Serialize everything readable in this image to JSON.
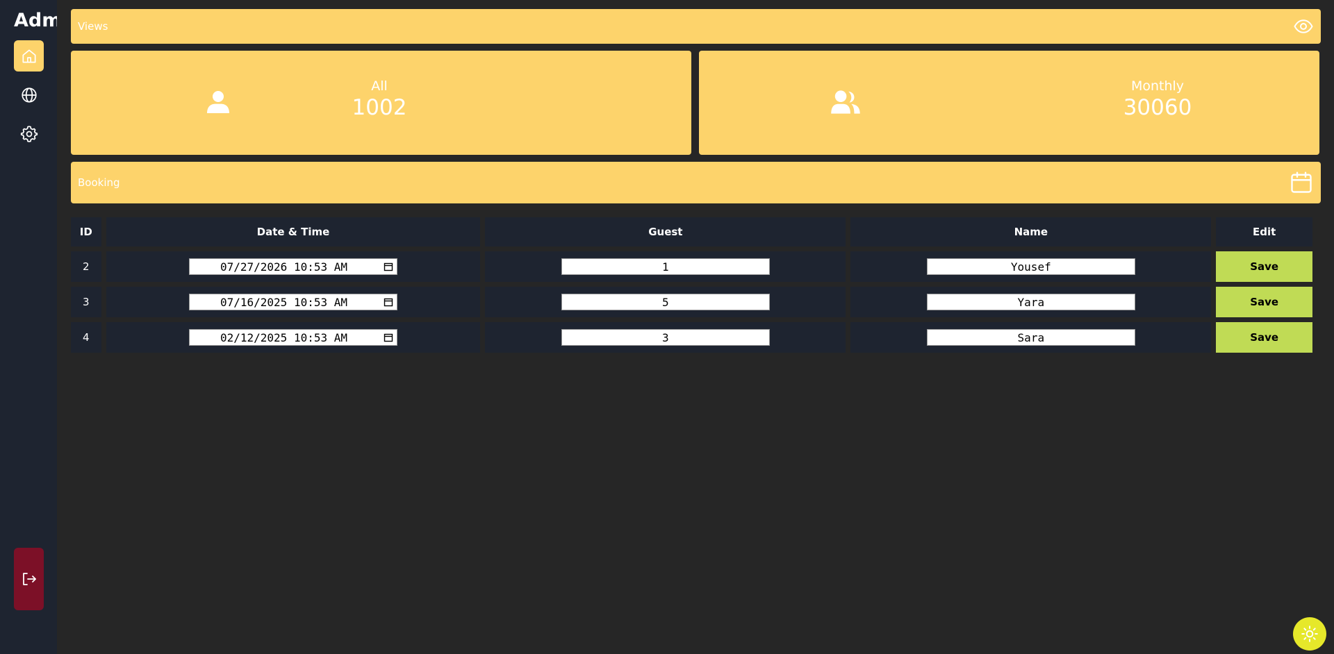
{
  "sidebar": {
    "brand": "Admin",
    "items": [
      {
        "icon": "home-icon"
      },
      {
        "icon": "globe-icon"
      },
      {
        "icon": "gear-icon"
      }
    ],
    "logout_icon": "logout-icon"
  },
  "views": {
    "title": "Views",
    "icon": "eye-icon"
  },
  "stats": {
    "all": {
      "label": "All",
      "value": "1002",
      "icon": "user-icon"
    },
    "monthly": {
      "label": "Monthly",
      "value": "30060",
      "icon": "users-icon"
    }
  },
  "booking": {
    "title": "Booking",
    "icon": "calendar-icon"
  },
  "table": {
    "headers": [
      "ID",
      "Date & Time",
      "Guest",
      "Name",
      "Edit"
    ],
    "rows": [
      {
        "id": "2",
        "datetime": "07/27/2026 10:53 AM",
        "guest": "1",
        "name": "Yousef",
        "action": "Save"
      },
      {
        "id": "3",
        "datetime": "07/16/2025 10:53 AM",
        "guest": "5",
        "name": "Yara",
        "action": "Save"
      },
      {
        "id": "4",
        "datetime": "02/12/2025 10:53 AM",
        "guest": "3",
        "name": "Sara",
        "action": "Save"
      }
    ]
  },
  "theme_toggle": {
    "icon": "sun-icon"
  },
  "colors": {
    "accent": "#fdd36b",
    "save": "#c0db55",
    "logout": "#7c1027",
    "theme_toggle": "#e6e82a"
  }
}
